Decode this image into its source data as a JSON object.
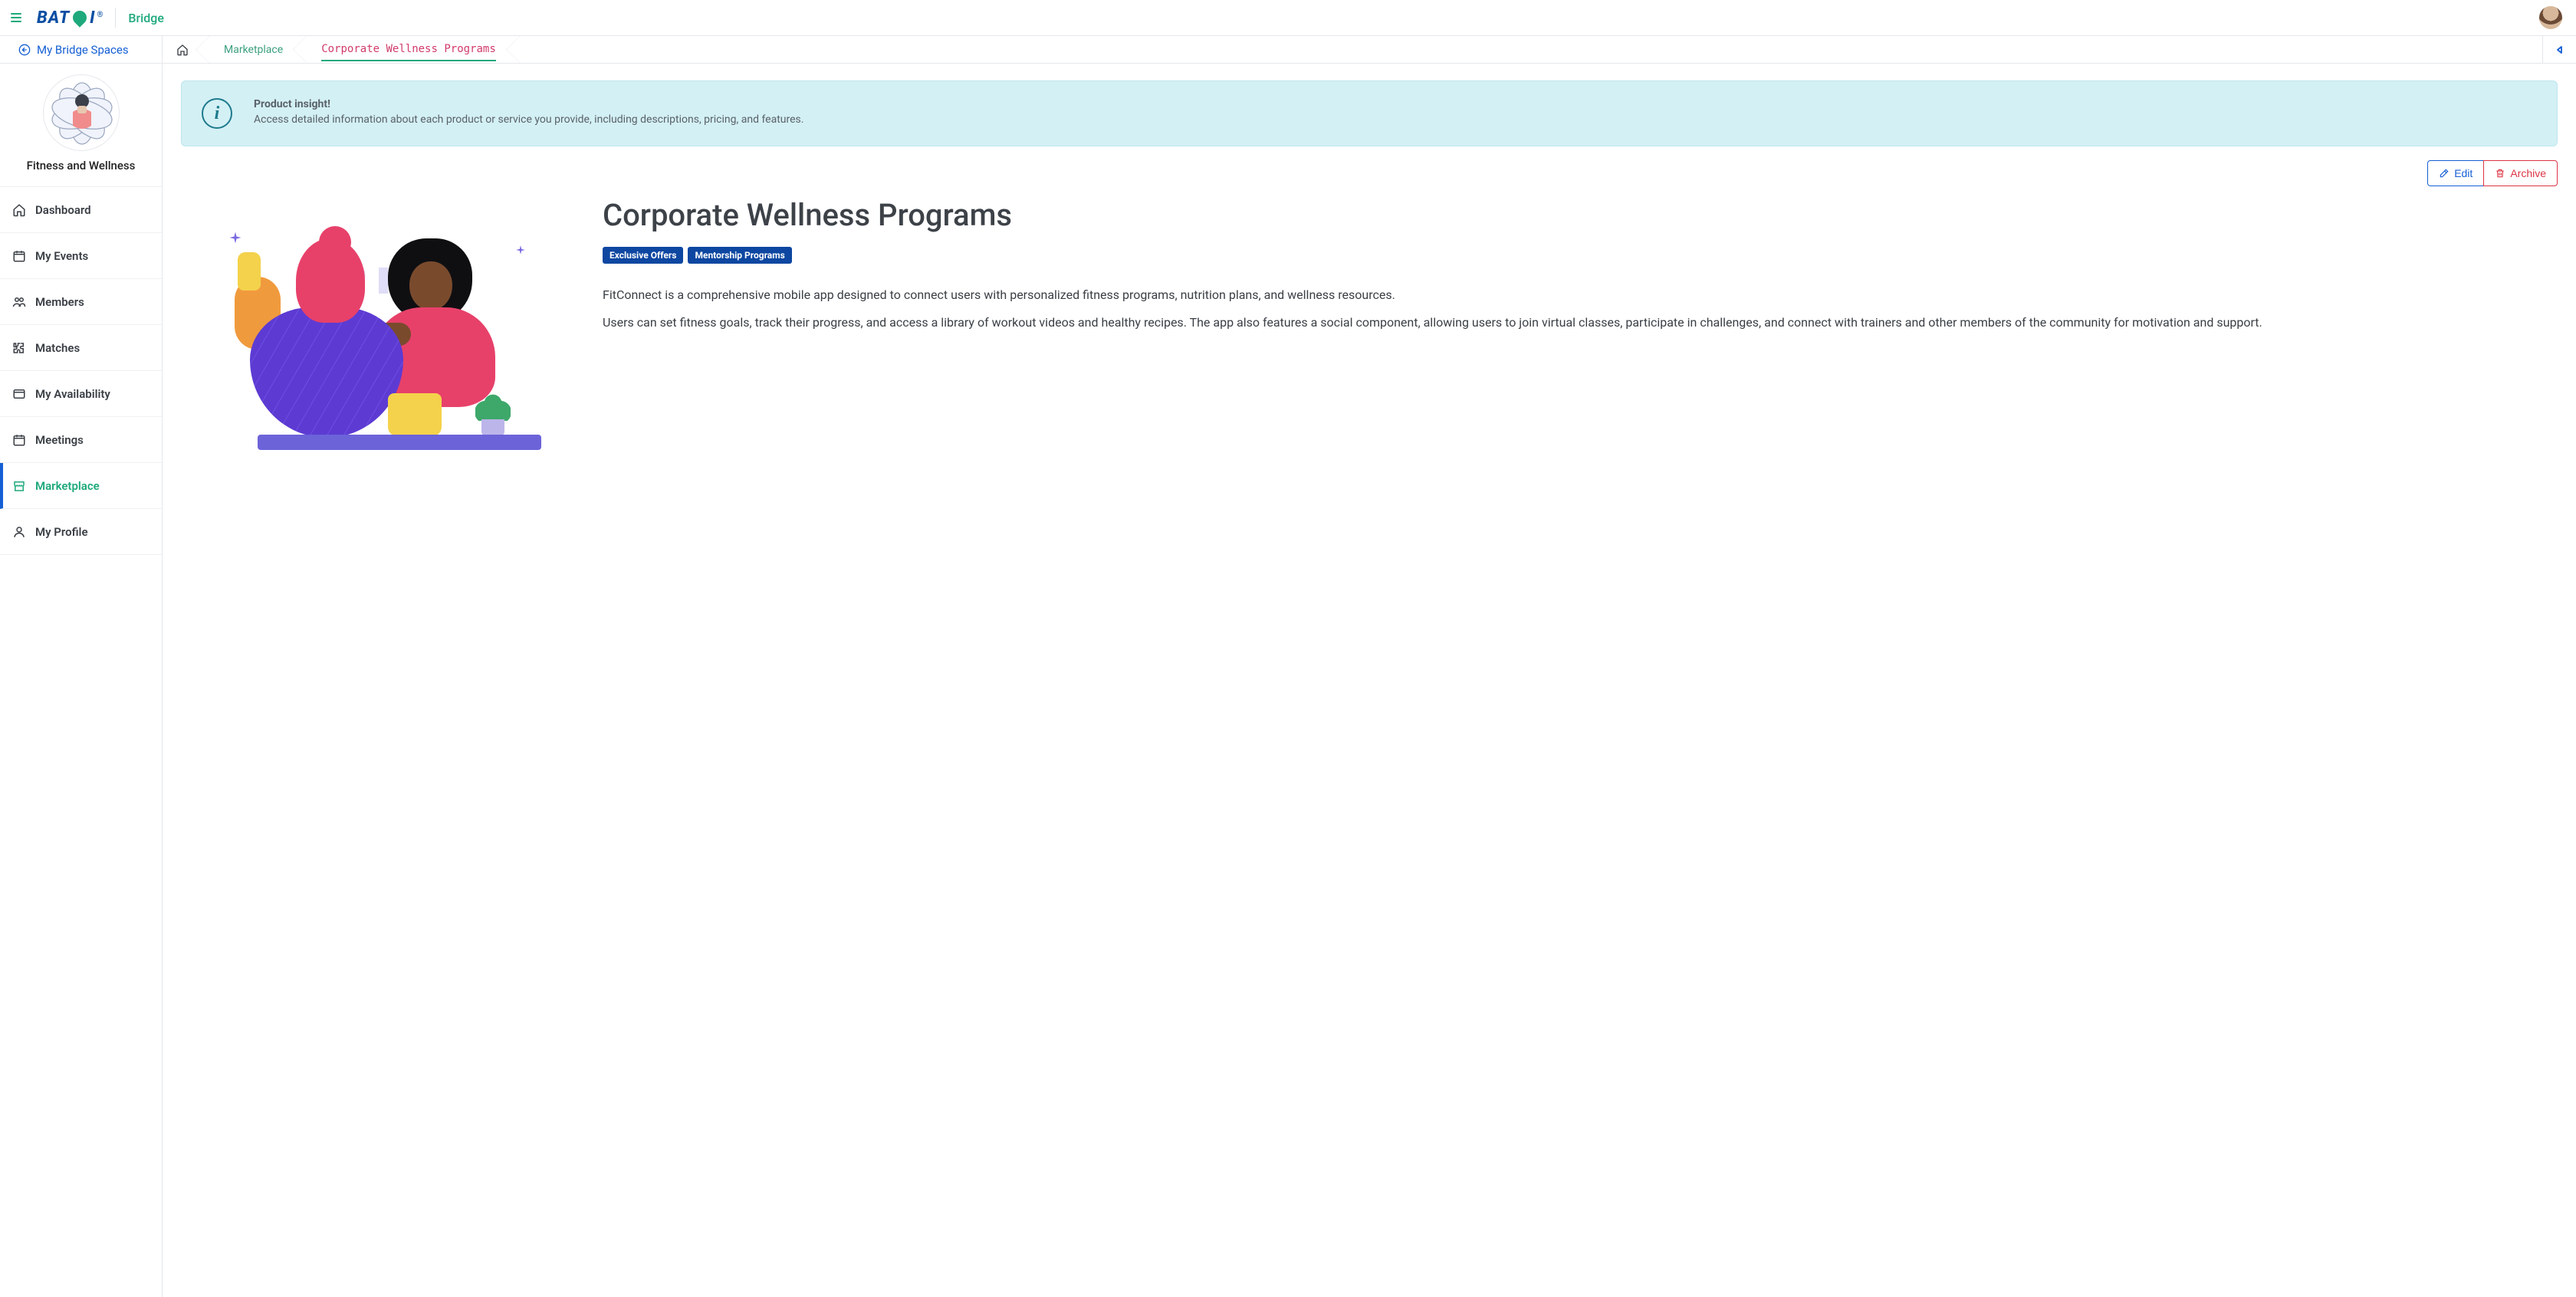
{
  "topbar": {
    "logo_text_left": "BAT",
    "logo_text_right": "I",
    "bridge_label": "Bridge"
  },
  "crumbbar": {
    "back_label": "My Bridge Spaces",
    "items": [
      {
        "label": "Marketplace"
      },
      {
        "label": "Corporate Wellness Programs",
        "active": true
      }
    ]
  },
  "sidebar": {
    "space_title": "Fitness and Wellness",
    "items": [
      {
        "icon": "home",
        "label": "Dashboard"
      },
      {
        "icon": "calendar",
        "label": "My Events"
      },
      {
        "icon": "users",
        "label": "Members"
      },
      {
        "icon": "puzzle",
        "label": "Matches"
      },
      {
        "icon": "window",
        "label": "My Availability"
      },
      {
        "icon": "calendar",
        "label": "Meetings"
      },
      {
        "icon": "shop",
        "label": "Marketplace",
        "active": true
      },
      {
        "icon": "user",
        "label": "My Profile"
      }
    ]
  },
  "banner": {
    "title": "Product insight!",
    "text": "Access detailed information about each product or service you provide, including descriptions, pricing, and features."
  },
  "actions": {
    "edit_label": "Edit",
    "archive_label": "Archive"
  },
  "product": {
    "title": "Corporate Wellness Programs",
    "badges": [
      "Exclusive Offers",
      "Mentorship Programs"
    ],
    "paragraphs": [
      "FitConnect is a comprehensive mobile app designed to connect users with personalized fitness programs, nutrition plans, and wellness resources.",
      "Users can set fitness goals, track their progress, and access a library of workout videos and healthy recipes. The app also features a social component, allowing users to join virtual classes, participate in challenges, and connect with trainers and other members of the community for motivation and support."
    ]
  }
}
